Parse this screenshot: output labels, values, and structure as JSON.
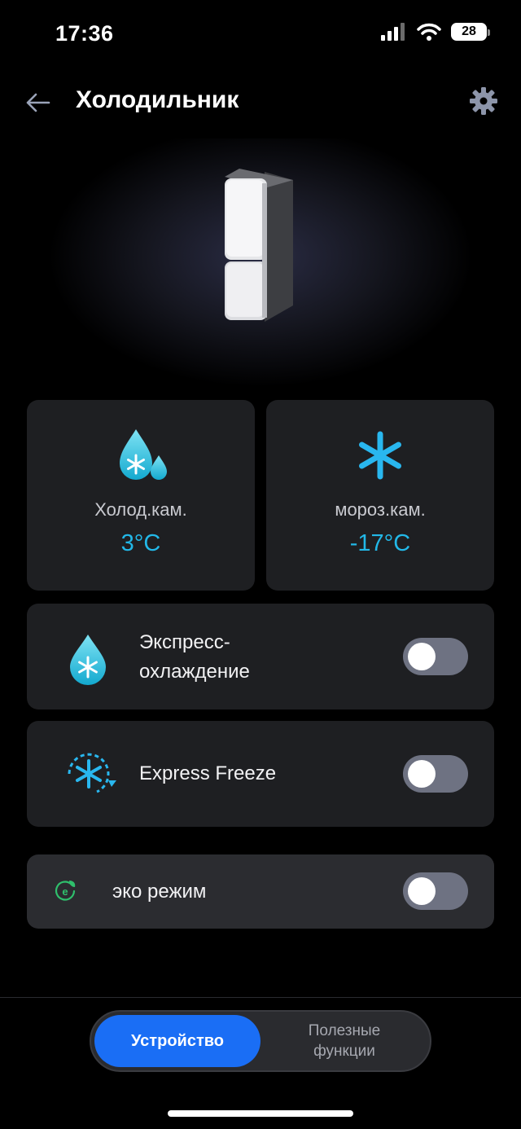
{
  "status_bar": {
    "time": "17:36",
    "battery": "28",
    "icons": [
      "signal-icon",
      "wifi-icon",
      "battery-icon"
    ]
  },
  "header": {
    "title": "Холодильник",
    "back_icon": "back-arrow-icon",
    "settings_icon": "gear-icon"
  },
  "zones": [
    {
      "label": "Холод.кам.",
      "value": "3°C",
      "icon": "water-drop-snowflake-icon"
    },
    {
      "label": "мороз.кам.",
      "value": "-17°C",
      "icon": "snowflake-icon"
    }
  ],
  "toggles": [
    {
      "label_line1": "Экспресс-",
      "label_line2": "охлаждение",
      "icon": "drop-snowflake-icon",
      "on": false
    },
    {
      "label": "Express Freeze",
      "icon": "freeze-cycle-icon",
      "on": false
    },
    {
      "label": "эко режим",
      "icon": "eco-leaf-icon",
      "on": false
    }
  ],
  "bottom_nav": {
    "active": "Устройство",
    "inactive_line1": "Полезные",
    "inactive_line2": "функции"
  },
  "colors": {
    "accent": "#1a6ef5",
    "temperature": "#22b8e8",
    "card": "#1e1f22",
    "eco": "#2fbf6c"
  }
}
